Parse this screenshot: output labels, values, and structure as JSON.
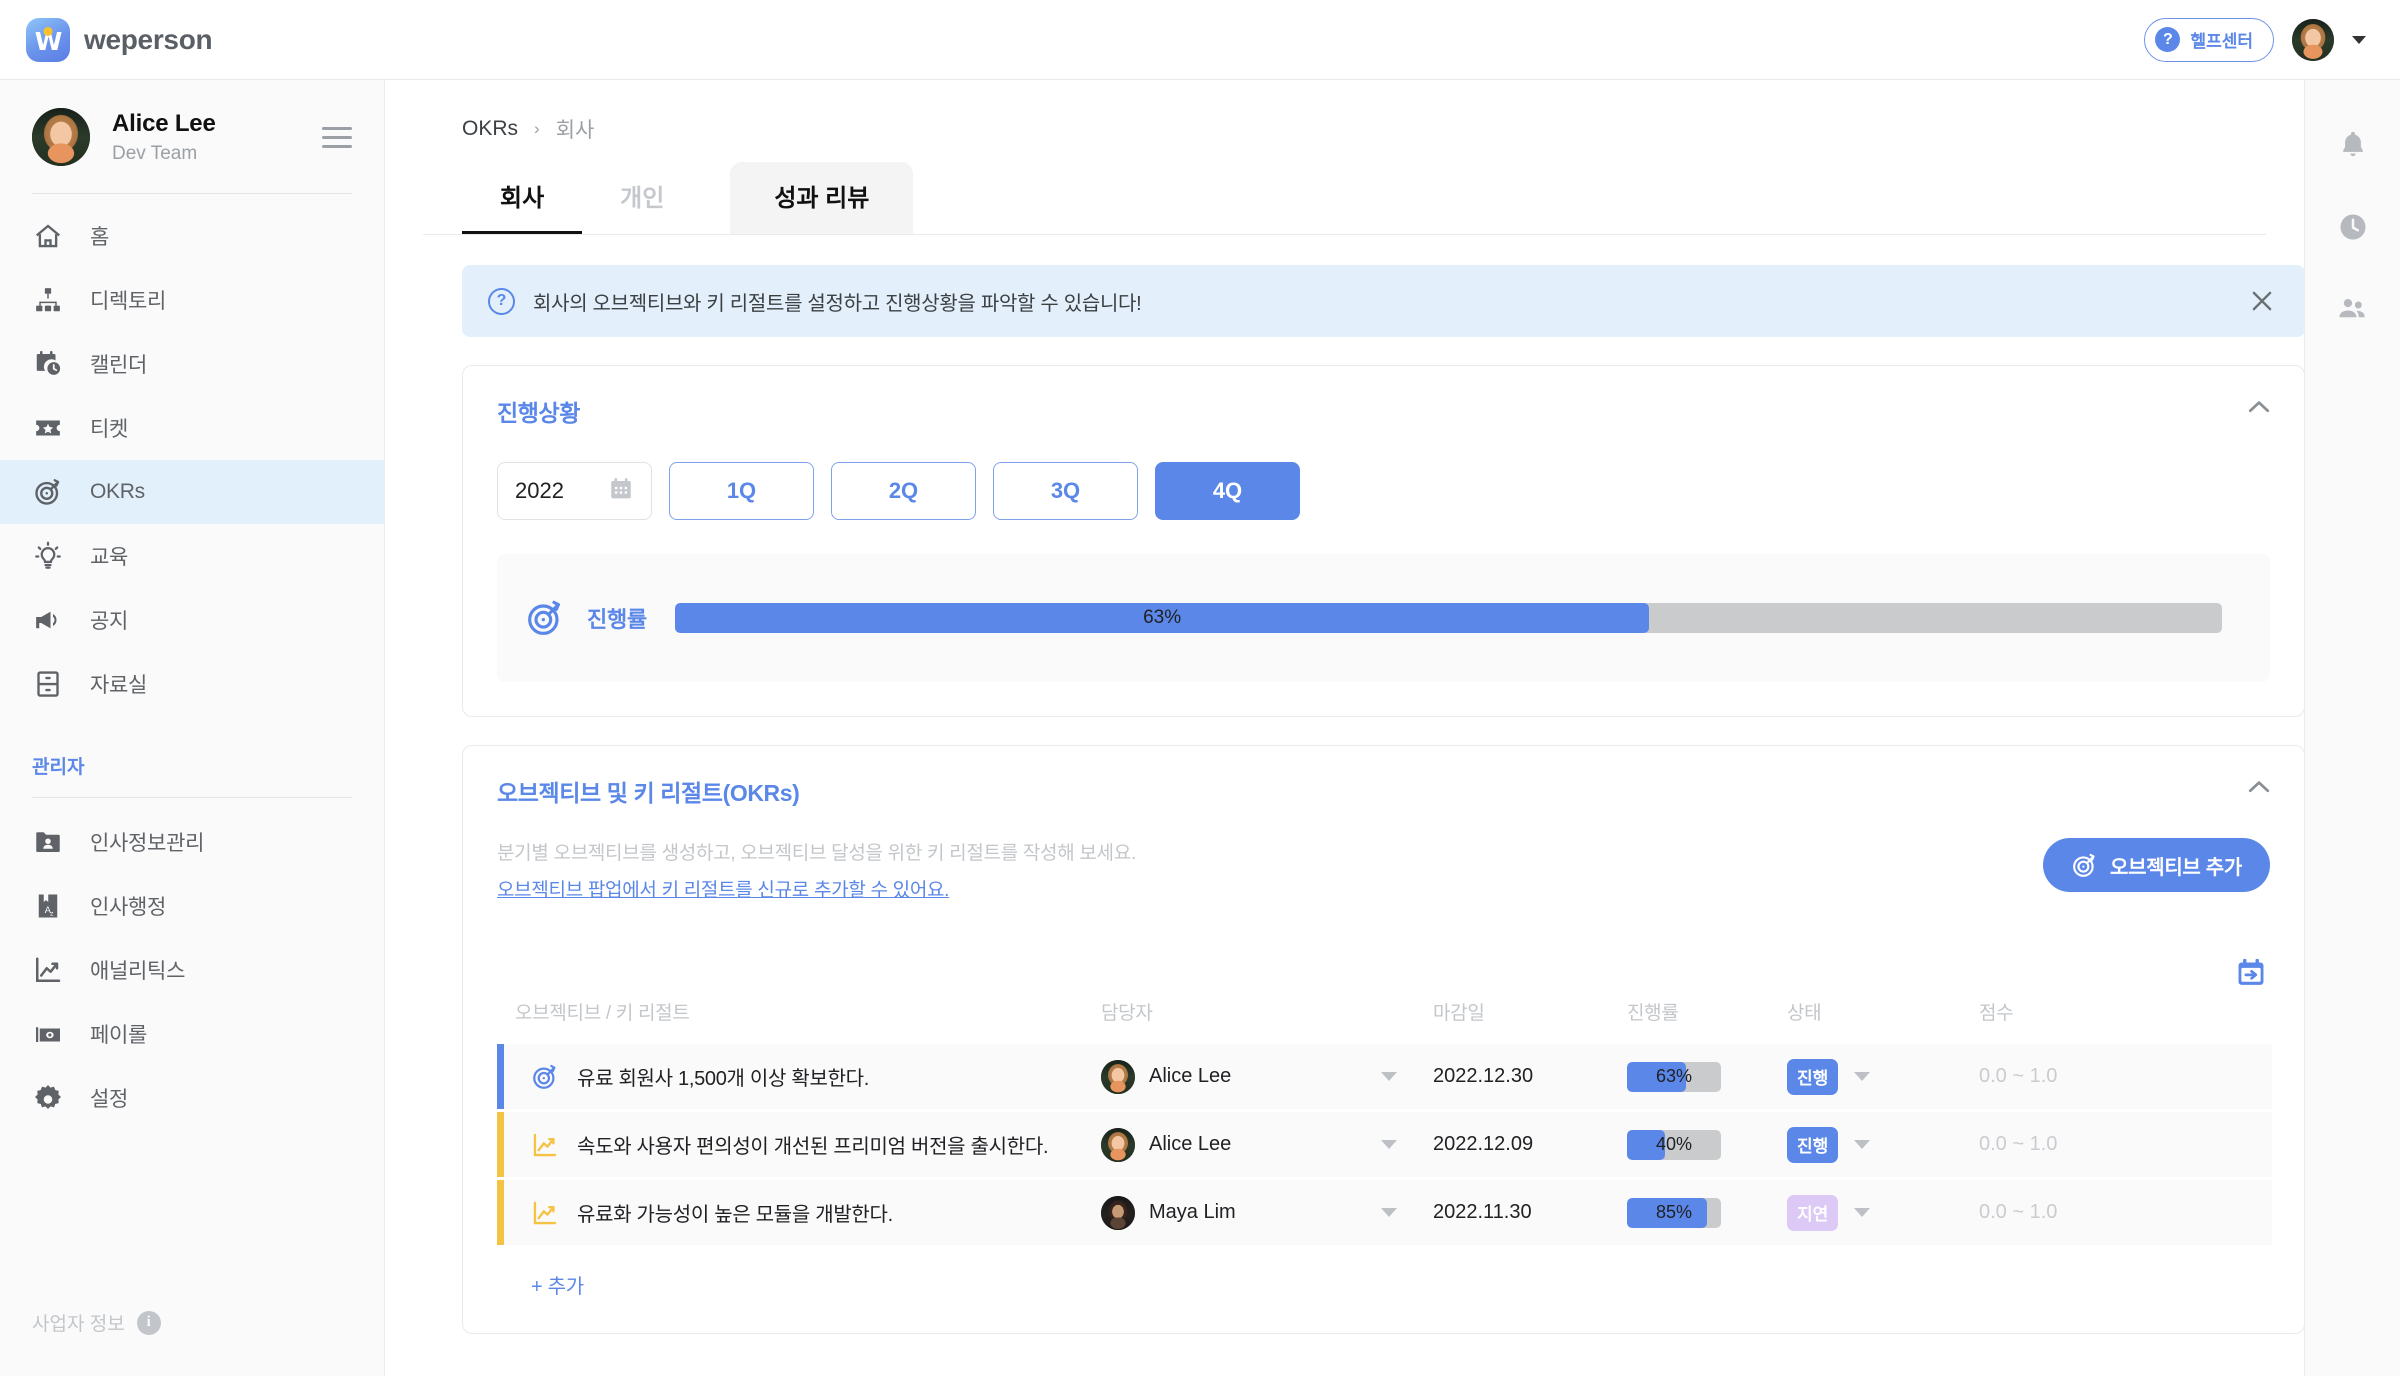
{
  "brand": {
    "name": "weperson",
    "logo_letter": "W"
  },
  "header": {
    "help_label": "헬프센터",
    "help_icon": "question-mark-icon",
    "avatar_icon": "user-avatar",
    "caret_icon": "chevron-down-icon"
  },
  "sidebar": {
    "user": {
      "name": "Alice Lee",
      "team": "Dev Team"
    },
    "menu_icon": "hamburger-menu-icon",
    "items": [
      {
        "label": "홈",
        "icon": "home-icon",
        "active": false
      },
      {
        "label": "디렉토리",
        "icon": "org-chart-icon",
        "active": false
      },
      {
        "label": "캘린더",
        "icon": "calendar-clock-icon",
        "active": false
      },
      {
        "label": "티켓",
        "icon": "ticket-star-icon",
        "active": false
      },
      {
        "label": "OKRs",
        "icon": "target-icon",
        "active": true
      },
      {
        "label": "교육",
        "icon": "lightbulb-icon",
        "active": false
      },
      {
        "label": "공지",
        "icon": "megaphone-icon",
        "active": false
      },
      {
        "label": "자료실",
        "icon": "archive-icon",
        "active": false
      }
    ],
    "admin_heading": "관리자",
    "admin_items": [
      {
        "label": "인사정보관리",
        "icon": "folder-person-icon"
      },
      {
        "label": "인사행정",
        "icon": "book-az-icon"
      },
      {
        "label": "애널리틱스",
        "icon": "line-chart-icon"
      },
      {
        "label": "페이롤",
        "icon": "money-icon"
      },
      {
        "label": "설정",
        "icon": "gear-icon"
      }
    ],
    "business_info": "사업자 정보",
    "business_info_icon": "info-icon"
  },
  "rail": {
    "items": [
      {
        "icon": "bell-icon",
        "name": "notifications"
      },
      {
        "icon": "clock-icon",
        "name": "recent"
      },
      {
        "icon": "people-icon",
        "name": "contacts"
      }
    ]
  },
  "breadcrumb": {
    "root": "OKRs",
    "separator": "›",
    "current": "회사"
  },
  "tabs": [
    {
      "label": "회사",
      "state": "active"
    },
    {
      "label": "개인",
      "state": "inactive"
    },
    {
      "label": "성과 리뷰",
      "state": "boxed"
    }
  ],
  "banner": {
    "icon": "question-circle-icon",
    "text": "회사의 오브젝티브와 키 리절트를 설정하고 진행상황을 파악할 수 있습니다!",
    "close_icon": "close-icon"
  },
  "progress_card": {
    "title": "진행상황",
    "collapse_icon": "chevron-up-icon",
    "year": "2022",
    "year_icon": "calendar-icon",
    "quarters": [
      {
        "label": "1Q",
        "selected": false
      },
      {
        "label": "2Q",
        "selected": false
      },
      {
        "label": "3Q",
        "selected": false
      },
      {
        "label": "4Q",
        "selected": true
      }
    ],
    "rate_icon": "target-icon",
    "rate_label": "진행률",
    "rate_value": "63%",
    "rate_percent": 63
  },
  "okr_card": {
    "title": "오브젝티브 및 키 리절트(OKRs)",
    "collapse_icon": "chevron-up-icon",
    "description": "분기별 오브젝티브를 생성하고, 오브젝티브 달성을 위한 키 리절트를 작성해 보세요.",
    "link_text": "오브젝티브 팝업에서 키 리절트를 신규로 추가할 수 있어요.",
    "add_button": {
      "label": "오브젝티브 추가",
      "icon": "target-icon"
    },
    "export_icon": "calendar-export-icon",
    "columns": [
      "오브젝티브 / 키 리절트",
      "담당자",
      "마감일",
      "진행률",
      "상태",
      "점수"
    ],
    "rows": [
      {
        "accent": "#5b87e8",
        "row_icon": "target-icon",
        "title": "유료 회원사 1,500개 이상 확보한다.",
        "owner": "Alice Lee",
        "owner_avatar": "light",
        "due": "2022.12.30",
        "progress_label": "63%",
        "progress": 63,
        "status": "진행",
        "status_kind": "prog",
        "score": "0.0 ~ 1.0"
      },
      {
        "accent": "#f5c344",
        "row_icon": "line-chart-icon",
        "title": "속도와 사용자 편의성이 개선된 프리미엄 버전을 출시한다.",
        "owner": "Alice Lee",
        "owner_avatar": "light",
        "due": "2022.12.09",
        "progress_label": "40%",
        "progress": 40,
        "status": "진행",
        "status_kind": "prog",
        "score": "0.0 ~ 1.0"
      },
      {
        "accent": "#f5c344",
        "row_icon": "line-chart-icon",
        "title": "유료화 가능성이 높은 모듈을 개발한다.",
        "owner": "Maya Lim",
        "owner_avatar": "dark",
        "due": "2022.11.30",
        "progress_label": "85%",
        "progress": 85,
        "status": "지연",
        "status_kind": "late",
        "score": "0.0 ~ 1.0"
      }
    ],
    "add_row_label": "+ 추가"
  },
  "colors": {
    "accent": "#5b87e8",
    "banner_bg": "#e3f0fb",
    "sidebar_active": "#e2f0fb",
    "progress_track": "#c9cbcd",
    "status_late": "#ddc9f5",
    "accent_yellow": "#f5c344"
  }
}
